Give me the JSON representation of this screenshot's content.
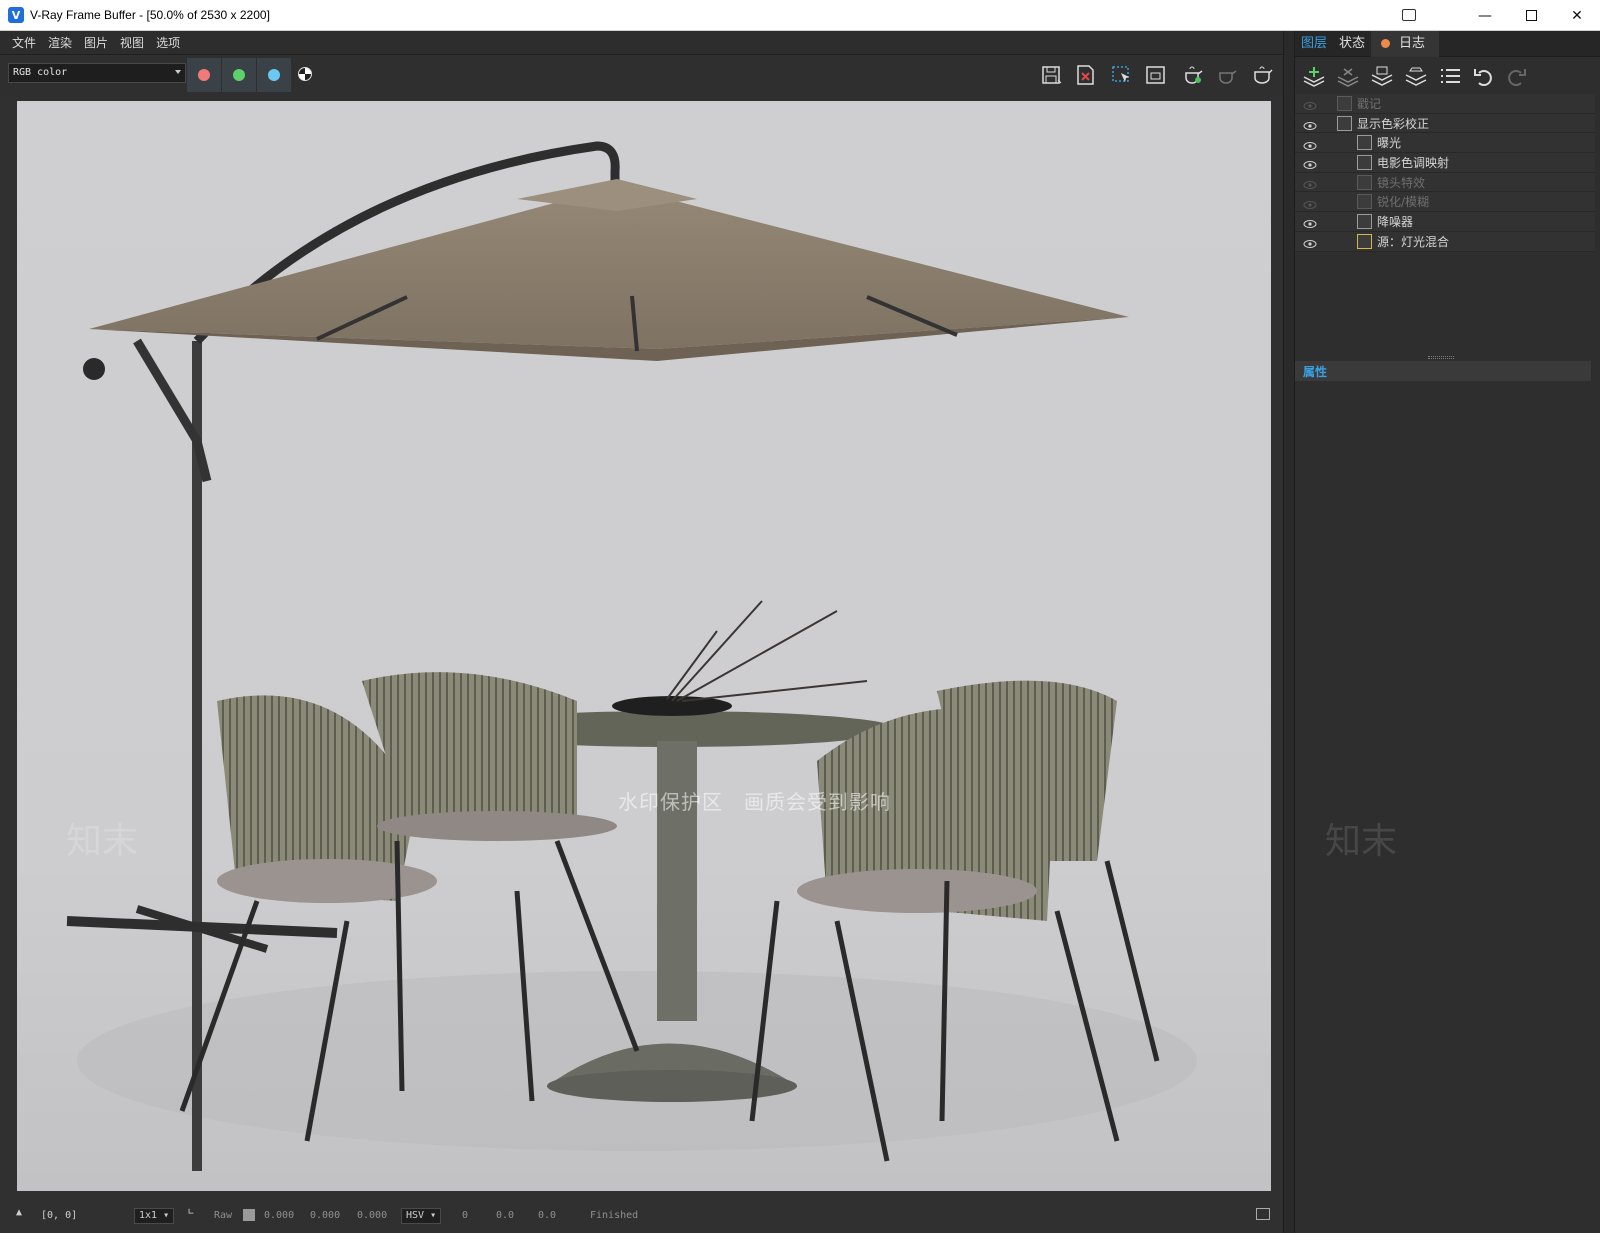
{
  "window": {
    "title": "V-Ray Frame Buffer - [50.0% of 2530 x 2200]",
    "app_icon": "V",
    "controls": [
      "minimize-icon",
      "maximize-icon",
      "close-icon"
    ]
  },
  "menu": [
    "文件",
    "渲染",
    "图片",
    "视图",
    "选项"
  ],
  "toolbar": {
    "channel": "RGB color",
    "color_buttons": [
      {
        "name": "red",
        "color": "#f07a7a"
      },
      {
        "name": "green",
        "color": "#5cd06a"
      },
      {
        "name": "blue",
        "color": "#6cc8f0"
      }
    ],
    "right_icons": [
      "save-image-icon",
      "clear-image-icon",
      "region-render-icon",
      "render-region-icon",
      "render-icon",
      "render-interactive-icon",
      "stop-render-icon"
    ]
  },
  "right_panel": {
    "tabs": {
      "layers": "图层",
      "status": "状态",
      "log": "日志"
    },
    "layer_tool_icons": [
      "add-layer-icon",
      "remove-layer-icon",
      "save-layers-icon",
      "load-layers-icon",
      "layer-list-icon",
      "undo-icon",
      "redo-icon"
    ],
    "layers": [
      {
        "label": "戳记",
        "enabled": false,
        "indent": 0
      },
      {
        "label": "显示色彩校正",
        "enabled": true,
        "indent": 0
      },
      {
        "label": "曝光",
        "enabled": true,
        "indent": 1
      },
      {
        "label": "电影色调映射",
        "enabled": true,
        "indent": 1
      },
      {
        "label": "镜头特效",
        "enabled": false,
        "indent": 1
      },
      {
        "label": "锐化/模糊",
        "enabled": false,
        "indent": 1
      },
      {
        "label": "降噪器",
        "enabled": true,
        "indent": 1
      },
      {
        "label": "源：灯光混合",
        "enabled": true,
        "indent": 1
      }
    ],
    "properties_label": "属性"
  },
  "statusbar": {
    "coords": "[0, 0]",
    "zoom": "1x1",
    "raw_label": "Raw",
    "rgb": [
      "0.000",
      "0.000",
      "0.000"
    ],
    "color_mode": "HSV",
    "hsv": [
      "0",
      "0.0",
      "0.0"
    ],
    "status": "Finished"
  },
  "watermark": {
    "text": "知末",
    "banner": "水印保护区　画质会受到影响"
  },
  "colors": {
    "accent": "#3aa0e0",
    "background": "#303030",
    "render_bg": "#c9c9cb",
    "umbrella": "#8e816f"
  }
}
